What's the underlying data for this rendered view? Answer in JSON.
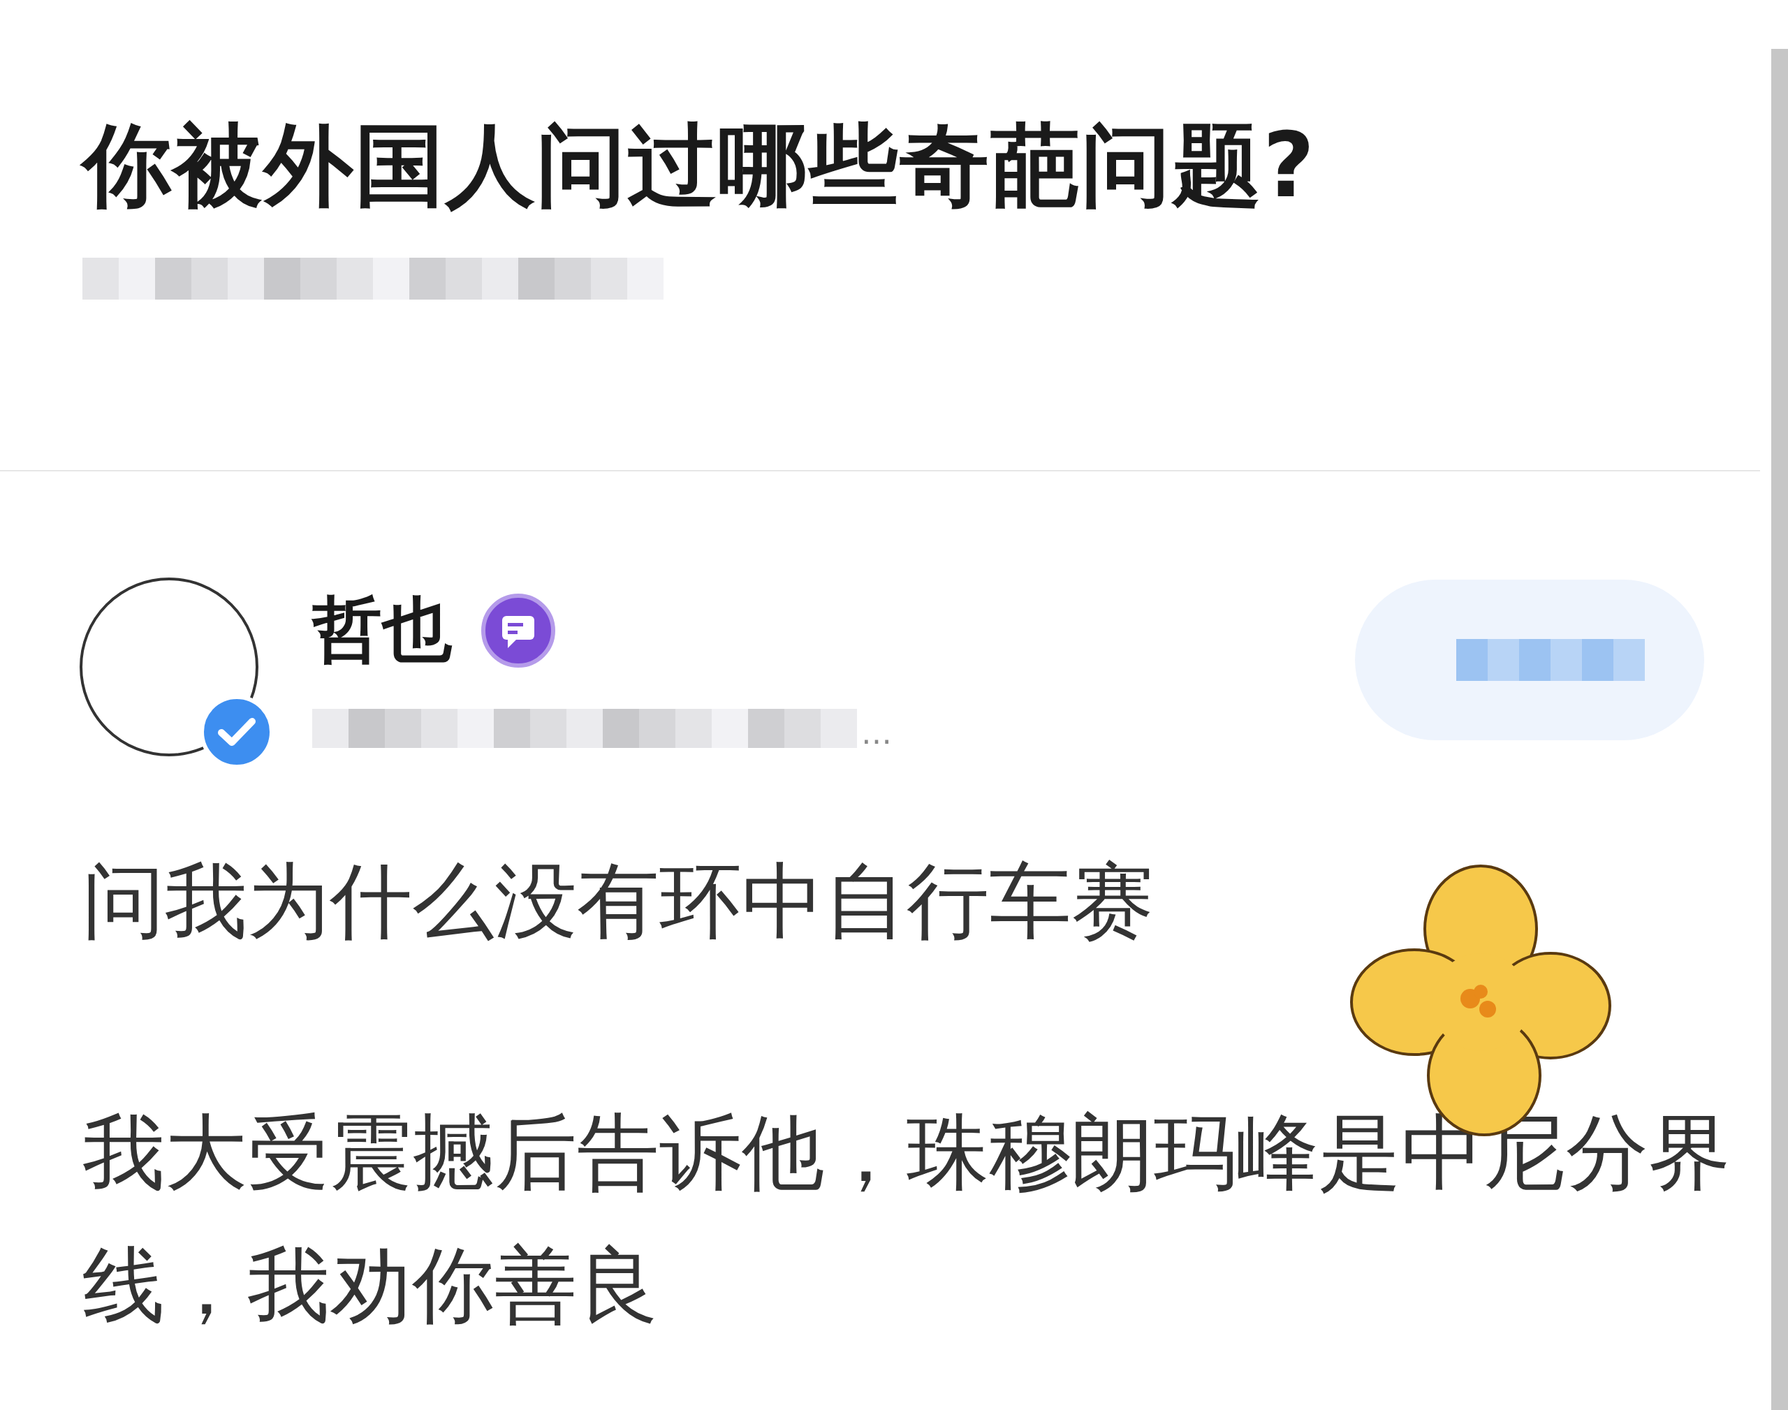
{
  "question": {
    "title": "你被外国人问过哪些奇葩问题?"
  },
  "answer": {
    "author": {
      "name": "哲也",
      "verified": true,
      "headline_tail": "…"
    },
    "paragraphs": [
      "问我为什么没有环中自行车赛",
      "我大受震撼后告诉他，珠穆朗玛峰是中尼分界线，我劝你善良"
    ]
  }
}
